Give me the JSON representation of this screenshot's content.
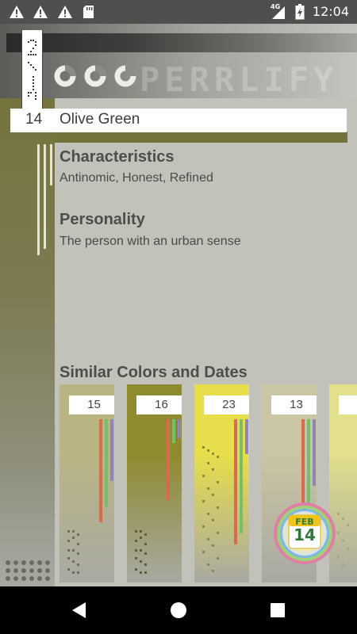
{
  "status_bar": {
    "time": "12:04",
    "network": "4G",
    "icons": [
      "warning-icon",
      "warning-icon",
      "warning-icon",
      "sd-card-icon",
      "signal-icon",
      "battery-icon"
    ]
  },
  "header": {
    "ghost_text": "PERRLIFY",
    "ring_count": 3
  },
  "date_tab": {
    "label": "2/14"
  },
  "title": {
    "day": "14",
    "color_name": "Olive Green"
  },
  "sections": {
    "characteristics_title": "Characteristics",
    "characteristics_text": "Antinomic, Honest, Refined",
    "personality_title": "Personality",
    "personality_text": "The person with an urban sense",
    "similar_title": "Similar Colors and Dates"
  },
  "similar_cards": [
    {
      "date": "15",
      "color": "#b9b583"
    },
    {
      "date": "16",
      "color": "#8e8a2e"
    },
    {
      "date": "23",
      "color": "#e6de4a"
    },
    {
      "date": "13",
      "color": "#cac5a3"
    },
    {
      "date": "",
      "color": "#e2e08a"
    }
  ],
  "fab": {
    "month": "FEB",
    "day": "14"
  },
  "colors": {
    "olive": "#74733b",
    "background": "#c2c2bb",
    "bar_red": "#d96a4e",
    "bar_green": "#74c06a",
    "bar_purple": "#8f86b8"
  },
  "nav": {
    "buttons": [
      "back-icon",
      "home-icon",
      "recents-icon"
    ]
  }
}
